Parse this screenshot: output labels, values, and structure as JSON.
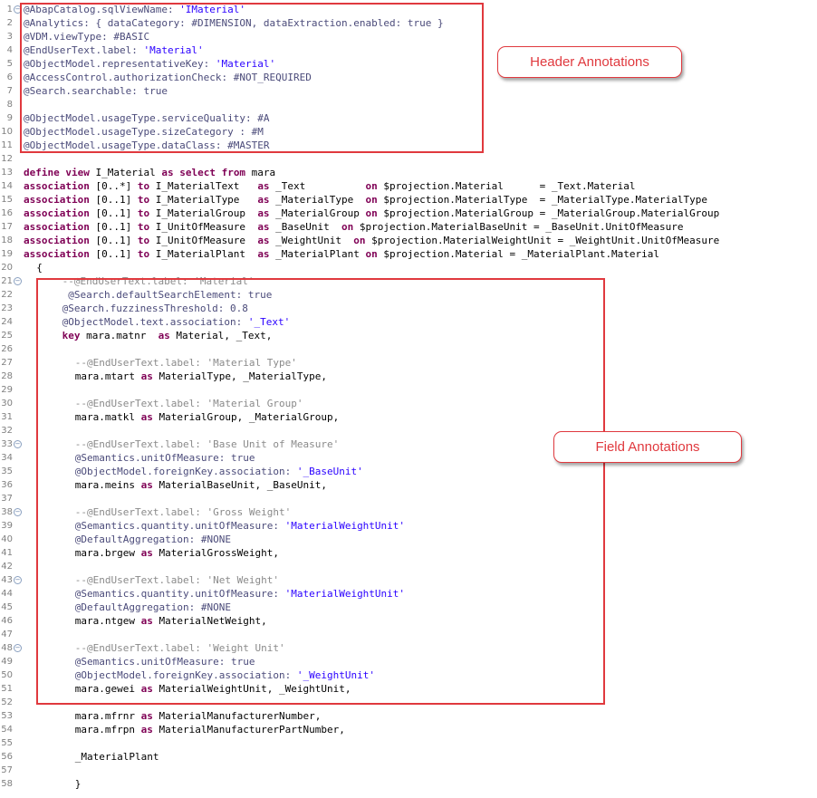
{
  "callouts": {
    "header": "Header Annotations",
    "field": "Field Annotations"
  },
  "colors": {
    "annotation": "#4b4b7a",
    "keyword": "#7f0055",
    "string": "#2a00ff",
    "comment": "#8a8a8a",
    "callout_border": "#e0393e"
  },
  "lines": [
    {
      "n": "1",
      "fold": "true",
      "indent": 0,
      "tokens": [
        [
          "a",
          "@AbapCatalog.sqlViewName: "
        ],
        [
          "s",
          "'IMaterial'"
        ]
      ]
    },
    {
      "n": "2",
      "indent": 0,
      "tokens": [
        [
          "a",
          "@Analytics: { dataCategory: #DIMENSION, dataExtraction.enabled: true }"
        ]
      ]
    },
    {
      "n": "3",
      "indent": 0,
      "tokens": [
        [
          "a",
          "@VDM.viewType: #BASIC"
        ]
      ]
    },
    {
      "n": "4",
      "indent": 0,
      "tokens": [
        [
          "a",
          "@EndUserText.label: "
        ],
        [
          "s",
          "'Material'"
        ]
      ]
    },
    {
      "n": "5",
      "indent": 0,
      "tokens": [
        [
          "a",
          "@ObjectModel.representativeKey: "
        ],
        [
          "s",
          "'Material'"
        ]
      ]
    },
    {
      "n": "6",
      "indent": 0,
      "tokens": [
        [
          "a",
          "@AccessControl.authorizationCheck: #NOT_REQUIRED"
        ]
      ]
    },
    {
      "n": "7",
      "indent": 0,
      "tokens": [
        [
          "a",
          "@Search.searchable: true"
        ]
      ]
    },
    {
      "n": "8",
      "indent": 0,
      "tokens": []
    },
    {
      "n": "9",
      "indent": 0,
      "tokens": [
        [
          "a",
          "@ObjectModel.usageType.serviceQuality: #A"
        ]
      ]
    },
    {
      "n": "10",
      "indent": 0,
      "tokens": [
        [
          "a",
          "@ObjectModel.usageType.sizeCategory : #M"
        ]
      ]
    },
    {
      "n": "11",
      "indent": 0,
      "tokens": [
        [
          "a",
          "@ObjectModel.usageType.dataClass: #MASTER"
        ]
      ]
    },
    {
      "n": "12",
      "indent": 0,
      "tokens": []
    },
    {
      "n": "13",
      "indent": 0,
      "tokens": [
        [
          "k",
          "define view"
        ],
        [
          "t",
          " I_Material "
        ],
        [
          "k",
          "as select from"
        ],
        [
          "t",
          " mara"
        ]
      ]
    },
    {
      "n": "14",
      "indent": 0,
      "tokens": [
        [
          "k",
          "association"
        ],
        [
          "t",
          " [0..*] "
        ],
        [
          "k",
          "to"
        ],
        [
          "t",
          " I_MaterialText   "
        ],
        [
          "k",
          "as"
        ],
        [
          "t",
          " _Text          "
        ],
        [
          "k",
          "on"
        ],
        [
          "t",
          " $projection.Material      = _Text.Material"
        ]
      ]
    },
    {
      "n": "15",
      "indent": 0,
      "tokens": [
        [
          "k",
          "association"
        ],
        [
          "t",
          " [0..1] "
        ],
        [
          "k",
          "to"
        ],
        [
          "t",
          " I_MaterialType   "
        ],
        [
          "k",
          "as"
        ],
        [
          "t",
          " _MaterialType  "
        ],
        [
          "k",
          "on"
        ],
        [
          "t",
          " $projection.MaterialType  = _MaterialType.MaterialType"
        ]
      ]
    },
    {
      "n": "16",
      "indent": 0,
      "tokens": [
        [
          "k",
          "association"
        ],
        [
          "t",
          " [0..1] "
        ],
        [
          "k",
          "to"
        ],
        [
          "t",
          " I_MaterialGroup  "
        ],
        [
          "k",
          "as"
        ],
        [
          "t",
          " _MaterialGroup "
        ],
        [
          "k",
          "on"
        ],
        [
          "t",
          " $projection.MaterialGroup = _MaterialGroup.MaterialGroup"
        ]
      ]
    },
    {
      "n": "17",
      "indent": 0,
      "tokens": [
        [
          "k",
          "association"
        ],
        [
          "t",
          " [0..1] "
        ],
        [
          "k",
          "to"
        ],
        [
          "t",
          " I_UnitOfMeasure  "
        ],
        [
          "k",
          "as"
        ],
        [
          "t",
          " _BaseUnit  "
        ],
        [
          "k",
          "on"
        ],
        [
          "t",
          " $projection.MaterialBaseUnit = _BaseUnit.UnitOfMeasure"
        ]
      ]
    },
    {
      "n": "18",
      "indent": 0,
      "tokens": [
        [
          "k",
          "association"
        ],
        [
          "t",
          " [0..1] "
        ],
        [
          "k",
          "to"
        ],
        [
          "t",
          " I_UnitOfMeasure  "
        ],
        [
          "k",
          "as"
        ],
        [
          "t",
          " _WeightUnit  "
        ],
        [
          "k",
          "on"
        ],
        [
          "t",
          " $projection.MaterialWeightUnit = _WeightUnit.UnitOfMeasure"
        ]
      ]
    },
    {
      "n": "19",
      "indent": 0,
      "tokens": [
        [
          "k",
          "association"
        ],
        [
          "t",
          " [0..1] "
        ],
        [
          "k",
          "to"
        ],
        [
          "t",
          " I_MaterialPlant  "
        ],
        [
          "k",
          "as"
        ],
        [
          "t",
          " _MaterialPlant "
        ],
        [
          "k",
          "on"
        ],
        [
          "t",
          " $projection.Material = _MaterialPlant.Material"
        ]
      ]
    },
    {
      "n": "20",
      "indent": 1,
      "tokens": [
        [
          "t",
          "{"
        ]
      ]
    },
    {
      "n": "21",
      "fold": "true",
      "indent": 3,
      "tokens": [
        [
          "c",
          "--@EndUserText.label: 'Material'"
        ]
      ]
    },
    {
      "n": "22",
      "indent": 3,
      "tokens": [
        [
          "a",
          " @Search.defaultSearchElement: true"
        ]
      ]
    },
    {
      "n": "23",
      "indent": 3,
      "tokens": [
        [
          "a",
          "@Search.fuzzinessThreshold: 0.8"
        ]
      ]
    },
    {
      "n": "24",
      "indent": 3,
      "tokens": [
        [
          "a",
          "@ObjectModel.text.association: "
        ],
        [
          "s",
          "'_Text'"
        ]
      ]
    },
    {
      "n": "25",
      "indent": 3,
      "tokens": [
        [
          "k",
          "key"
        ],
        [
          "t",
          " mara.matnr  "
        ],
        [
          "k",
          "as"
        ],
        [
          "t",
          " Material, _Text,"
        ]
      ]
    },
    {
      "n": "26",
      "indent": 0,
      "tokens": []
    },
    {
      "n": "27",
      "indent": 4,
      "tokens": [
        [
          "c",
          "--@EndUserText.label: 'Material Type'"
        ]
      ]
    },
    {
      "n": "28",
      "indent": 4,
      "tokens": [
        [
          "t",
          "mara.mtart "
        ],
        [
          "k",
          "as"
        ],
        [
          "t",
          " MaterialType, _MaterialType,"
        ]
      ]
    },
    {
      "n": "29",
      "indent": 0,
      "tokens": []
    },
    {
      "n": "30",
      "indent": 4,
      "tokens": [
        [
          "c",
          "--@EndUserText.label: 'Material Group'"
        ]
      ]
    },
    {
      "n": "31",
      "indent": 4,
      "tokens": [
        [
          "t",
          "mara.matkl "
        ],
        [
          "k",
          "as"
        ],
        [
          "t",
          " MaterialGroup, _MaterialGroup,"
        ]
      ]
    },
    {
      "n": "32",
      "indent": 0,
      "tokens": []
    },
    {
      "n": "33",
      "fold": "true",
      "indent": 4,
      "tokens": [
        [
          "c",
          "--@EndUserText.label: 'Base Unit of Measure'"
        ]
      ]
    },
    {
      "n": "34",
      "indent": 4,
      "tokens": [
        [
          "a",
          "@Semantics.unitOfMeasure: true"
        ]
      ]
    },
    {
      "n": "35",
      "indent": 4,
      "tokens": [
        [
          "a",
          "@ObjectModel.foreignKey.association: "
        ],
        [
          "s",
          "'_BaseUnit'"
        ]
      ]
    },
    {
      "n": "36",
      "indent": 4,
      "tokens": [
        [
          "t",
          "mara.meins "
        ],
        [
          "k",
          "as"
        ],
        [
          "t",
          " MaterialBaseUnit, _BaseUnit,"
        ]
      ]
    },
    {
      "n": "37",
      "indent": 0,
      "tokens": []
    },
    {
      "n": "38",
      "fold": "true",
      "indent": 4,
      "tokens": [
        [
          "c",
          "--@EndUserText.label: 'Gross Weight'"
        ]
      ]
    },
    {
      "n": "39",
      "indent": 4,
      "tokens": [
        [
          "a",
          "@Semantics.quantity.unitOfMeasure: "
        ],
        [
          "s",
          "'MaterialWeightUnit'"
        ]
      ]
    },
    {
      "n": "40",
      "indent": 4,
      "tokens": [
        [
          "a",
          "@DefaultAggregation: #NONE"
        ]
      ]
    },
    {
      "n": "41",
      "indent": 4,
      "tokens": [
        [
          "t",
          "mara.brgew "
        ],
        [
          "k",
          "as"
        ],
        [
          "t",
          " MaterialGrossWeight,"
        ]
      ]
    },
    {
      "n": "42",
      "indent": 0,
      "tokens": []
    },
    {
      "n": "43",
      "fold": "true",
      "indent": 4,
      "tokens": [
        [
          "c",
          "--@EndUserText.label: 'Net Weight'"
        ]
      ]
    },
    {
      "n": "44",
      "indent": 4,
      "tokens": [
        [
          "a",
          "@Semantics.quantity.unitOfMeasure: "
        ],
        [
          "s",
          "'MaterialWeightUnit'"
        ]
      ]
    },
    {
      "n": "45",
      "indent": 4,
      "tokens": [
        [
          "a",
          "@DefaultAggregation: #NONE"
        ]
      ]
    },
    {
      "n": "46",
      "indent": 4,
      "tokens": [
        [
          "t",
          "mara.ntgew "
        ],
        [
          "k",
          "as"
        ],
        [
          "t",
          " MaterialNetWeight,"
        ]
      ]
    },
    {
      "n": "47",
      "indent": 0,
      "tokens": []
    },
    {
      "n": "48",
      "fold": "true",
      "indent": 4,
      "tokens": [
        [
          "c",
          "--@EndUserText.label: 'Weight Unit'"
        ]
      ]
    },
    {
      "n": "49",
      "indent": 4,
      "tokens": [
        [
          "a",
          "@Semantics.unitOfMeasure: true"
        ]
      ]
    },
    {
      "n": "50",
      "indent": 4,
      "tokens": [
        [
          "a",
          "@ObjectModel.foreignKey.association: "
        ],
        [
          "s",
          "'_WeightUnit'"
        ]
      ]
    },
    {
      "n": "51",
      "indent": 4,
      "tokens": [
        [
          "t",
          "mara.gewei "
        ],
        [
          "k",
          "as"
        ],
        [
          "t",
          " MaterialWeightUnit, _WeightUnit,"
        ]
      ]
    },
    {
      "n": "52",
      "indent": 0,
      "tokens": []
    },
    {
      "n": "53",
      "indent": 4,
      "tokens": [
        [
          "t",
          "mara.mfrnr "
        ],
        [
          "k",
          "as"
        ],
        [
          "t",
          " MaterialManufacturerNumber,"
        ]
      ]
    },
    {
      "n": "54",
      "indent": 4,
      "tokens": [
        [
          "t",
          "mara.mfrpn "
        ],
        [
          "k",
          "as"
        ],
        [
          "t",
          " MaterialManufacturerPartNumber,"
        ]
      ]
    },
    {
      "n": "55",
      "indent": 0,
      "tokens": []
    },
    {
      "n": "56",
      "indent": 4,
      "tokens": [
        [
          "t",
          "_MaterialPlant"
        ]
      ]
    },
    {
      "n": "57",
      "indent": 0,
      "tokens": []
    },
    {
      "n": "58",
      "indent": 4,
      "tokens": [
        [
          "t",
          "}"
        ]
      ]
    }
  ]
}
